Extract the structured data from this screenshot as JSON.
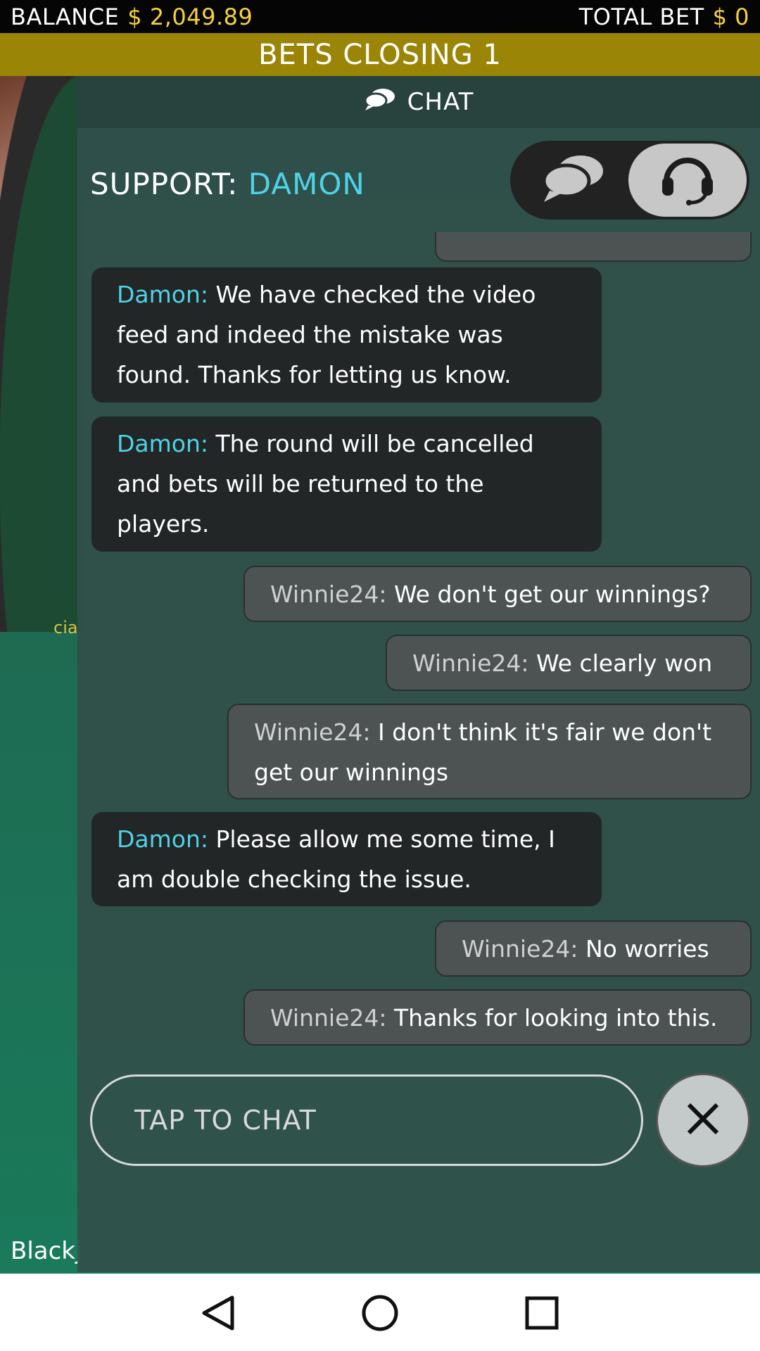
{
  "topbar": {
    "balance_label": "BALANCE",
    "balance_value": "$ 2,049.89",
    "total_bet_label": "TOTAL BET",
    "total_bet_value": "$ 0"
  },
  "banner": {
    "text": "BETS CLOSING 1"
  },
  "game": {
    "side_text": "cia",
    "table_name": "Blackj"
  },
  "chat": {
    "title": "CHAT",
    "support_label": "SUPPORT:",
    "support_name": "DAMON",
    "toggle": {
      "left_icon": "chat-bubbles-icon",
      "right_icon": "headset-icon",
      "selected": "headset"
    },
    "messages": [
      {
        "from": "agent",
        "author": "Damon:",
        "text": "We have checked the video feed and indeed the mistake was found. Thanks for letting us know."
      },
      {
        "from": "agent",
        "author": "Damon:",
        "text": "The round will be cancelled and bets will be returned to the players."
      },
      {
        "from": "user",
        "author": "Winnie24:",
        "text": "We don't get our winnings?"
      },
      {
        "from": "user",
        "author": "Winnie24:",
        "text": "We clearly won"
      },
      {
        "from": "user",
        "author": "Winnie24:",
        "text": "I don't think it's fair we don't get our winnings"
      },
      {
        "from": "agent",
        "author": "Damon:",
        "text": "Please allow me some time, I am double checking the issue."
      },
      {
        "from": "user",
        "author": "Winnie24:",
        "text": "No worries"
      },
      {
        "from": "user",
        "author": "Winnie24:",
        "text": "Thanks for looking into this."
      }
    ],
    "input_placeholder": "TAP TO CHAT",
    "close_icon": "close-icon"
  },
  "navbar": {
    "back_icon": "back-triangle-icon",
    "home_icon": "home-circle-icon",
    "recents_icon": "recents-square-icon"
  },
  "colors": {
    "gold": "#f5d23a",
    "banner": "#9b8506",
    "agent_name": "#4fd2e6"
  }
}
